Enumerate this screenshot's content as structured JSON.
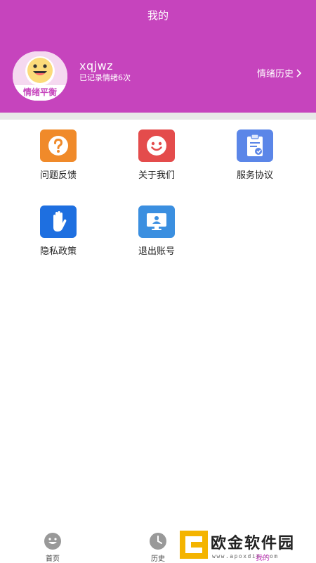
{
  "header": {
    "title": "我的",
    "avatar_text": "情绪平衡",
    "username": "xqjwz",
    "record_count": "已记录情绪6次",
    "history_link": "情绪历史",
    "accent_color": "#c644bd"
  },
  "menu": {
    "feedback": {
      "label": "问题反馈",
      "icon": "question-icon",
      "color": "#f08a2a"
    },
    "about": {
      "label": "关于我们",
      "icon": "smile-icon",
      "color": "#e44c4c"
    },
    "agreement": {
      "label": "服务协议",
      "icon": "clipboard-icon",
      "color": "#5b86e8"
    },
    "privacy": {
      "label": "隐私政策",
      "icon": "hand-icon",
      "color": "#1e6fe0"
    },
    "logout": {
      "label": "退出账号",
      "icon": "monitor-user-icon",
      "color": "#3b8fe0"
    }
  },
  "tabbar": {
    "home": {
      "label": "首页",
      "icon": "smile-icon"
    },
    "history": {
      "label": "历史",
      "icon": "clock-icon"
    },
    "mine": {
      "label": "我的",
      "icon": "user-icon"
    }
  },
  "watermark": {
    "text": "欧金软件园",
    "url": "www.apoxdin.com"
  }
}
